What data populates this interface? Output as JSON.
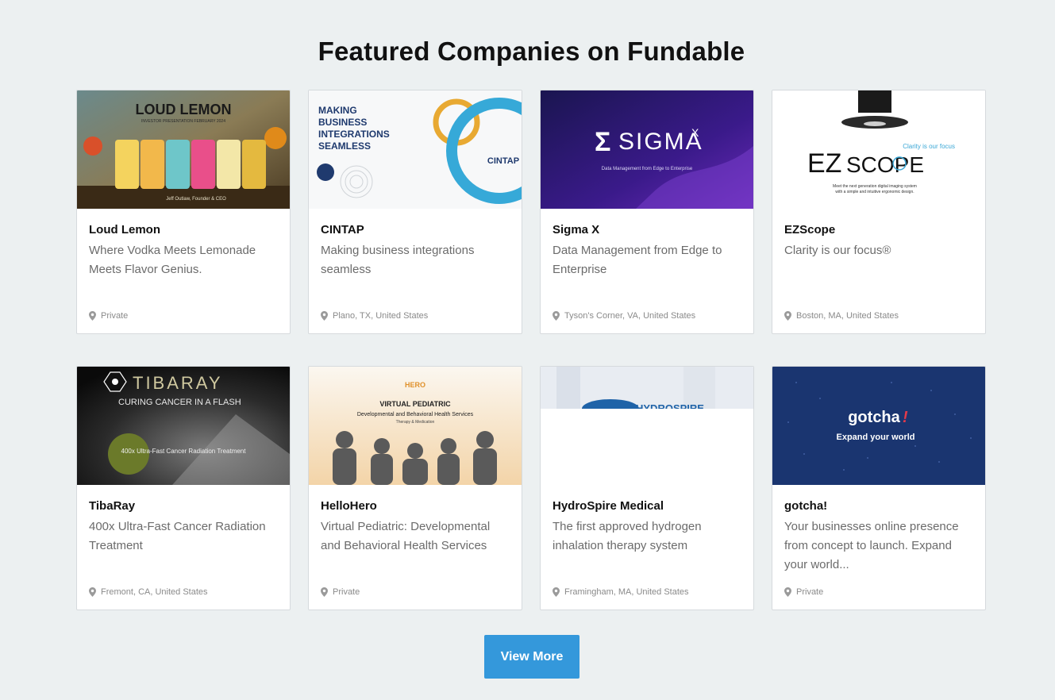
{
  "page": {
    "title": "Featured Companies on Fundable"
  },
  "thumbs": {
    "loud_lemon": {
      "line1": "LOUD LEMON",
      "line2": "INVESTOR PRESENTATION FEBRUARY 2024",
      "caption": "Jeff Outlaw, Founder & CEO"
    },
    "cintap": {
      "lines": [
        "MAKING",
        "BUSINESS",
        "INTEGRATIONS",
        "SEAMLESS"
      ],
      "logo": "CINTAP"
    },
    "sigma": {
      "logo": "SIGMA",
      "sup": "X",
      "tagline": "Data Management from Edge to Enterprise"
    },
    "ezscope": {
      "tagline": "Clarity is our focus",
      "brand_ez": "EZ",
      "brand_scope": "SCOPE",
      "sub1": "Meet the next generation digital imaging system",
      "sub2": "with a simple and intuitive ergonomic design."
    },
    "tibaray": {
      "logo": "TIBARAY",
      "tagline": "CURING CANCER IN A FLASH",
      "sub": "400x Ultra-Fast Cancer Radiation Treatment"
    },
    "hellohero": {
      "logo": "HERO",
      "heading": "VIRTUAL PEDIATRIC",
      "sub": "Developmental and Behavioral Health Services",
      "small": "Therapy & Medication"
    },
    "hydrospire": {
      "logo": "HYDROSPIRE"
    },
    "gotcha": {
      "logo": "gotcha",
      "bang": "!",
      "tagline": "Expand your world"
    }
  },
  "companies": [
    {
      "name": "Loud Lemon",
      "description": "Where Vodka Meets Lemonade Meets Flavor Genius.",
      "location": "Private"
    },
    {
      "name": "CINTAP",
      "description": "Making business integrations seamless",
      "location": "Plano, TX, United States"
    },
    {
      "name": "Sigma X",
      "description": "Data Management from Edge to Enterprise",
      "location": "Tyson's Corner, VA, United States"
    },
    {
      "name": "EZScope",
      "description": "Clarity is our focus®",
      "location": "Boston, MA, United States"
    },
    {
      "name": "TibaRay",
      "description": "400x Ultra-Fast Cancer Radiation Treatment",
      "location": "Fremont, CA, United States"
    },
    {
      "name": "HelloHero",
      "description": "Virtual Pediatric: Developmental and Behavioral Health Services",
      "location": "Private"
    },
    {
      "name": "HydroSpire Medical",
      "description": "The first approved hydrogen inhalation therapy system",
      "location": "Framingham, MA, United States"
    },
    {
      "name": "gotcha!",
      "description": "Your businesses online presence from concept to launch. Expand your world...",
      "location": "Private"
    }
  ],
  "view_more": {
    "label": "View More"
  },
  "colors": {
    "background": "#ecf0f1",
    "button": "#3498db",
    "card_border": "#d6dadd"
  }
}
